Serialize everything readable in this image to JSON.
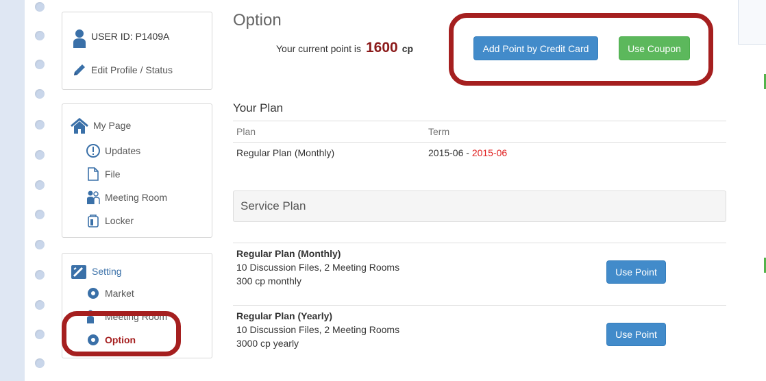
{
  "profile": {
    "user_id": "USER ID: P1409A",
    "edit_profile": "Edit Profile / Status"
  },
  "mypage": {
    "title": "My Page",
    "items": [
      "Updates",
      "File",
      "Meeting Room",
      "Locker"
    ]
  },
  "setting": {
    "title": "Setting",
    "items": [
      "Market",
      "Meeting Room",
      "Option"
    ]
  },
  "main": {
    "heading": "Option",
    "point_prefix": "Your current point is",
    "point_value": "1600",
    "point_unit": "cp",
    "add_point_button": "Add Point by Credit Card",
    "use_coupon_button": "Use Coupon",
    "your_plan_title": "Your Plan",
    "plan_table": {
      "headers": [
        "Plan",
        "Term"
      ],
      "rows": [
        {
          "plan": "Regular Plan (Monthly)",
          "term_start": "2015-06 -",
          "term_end": "2015-06"
        }
      ]
    },
    "service_plan_title": "Service Plan",
    "service_plans": [
      {
        "name": "Regular Plan (Monthly)",
        "details": "10 Discussion Files, 2 Meeting Rooms",
        "price": "300 cp monthly",
        "button": "Use Point"
      },
      {
        "name": "Regular Plan (Yearly)",
        "details": "10 Discussion Files, 2 Meeting Rooms",
        "price": "3000 cp yearly",
        "button": "Use Point"
      }
    ]
  },
  "colors": {
    "accent": "#428bca",
    "success": "#5cb85c",
    "highlight": "#a51f1f",
    "term_end": "#e02020",
    "point": "#8b1a1a"
  }
}
